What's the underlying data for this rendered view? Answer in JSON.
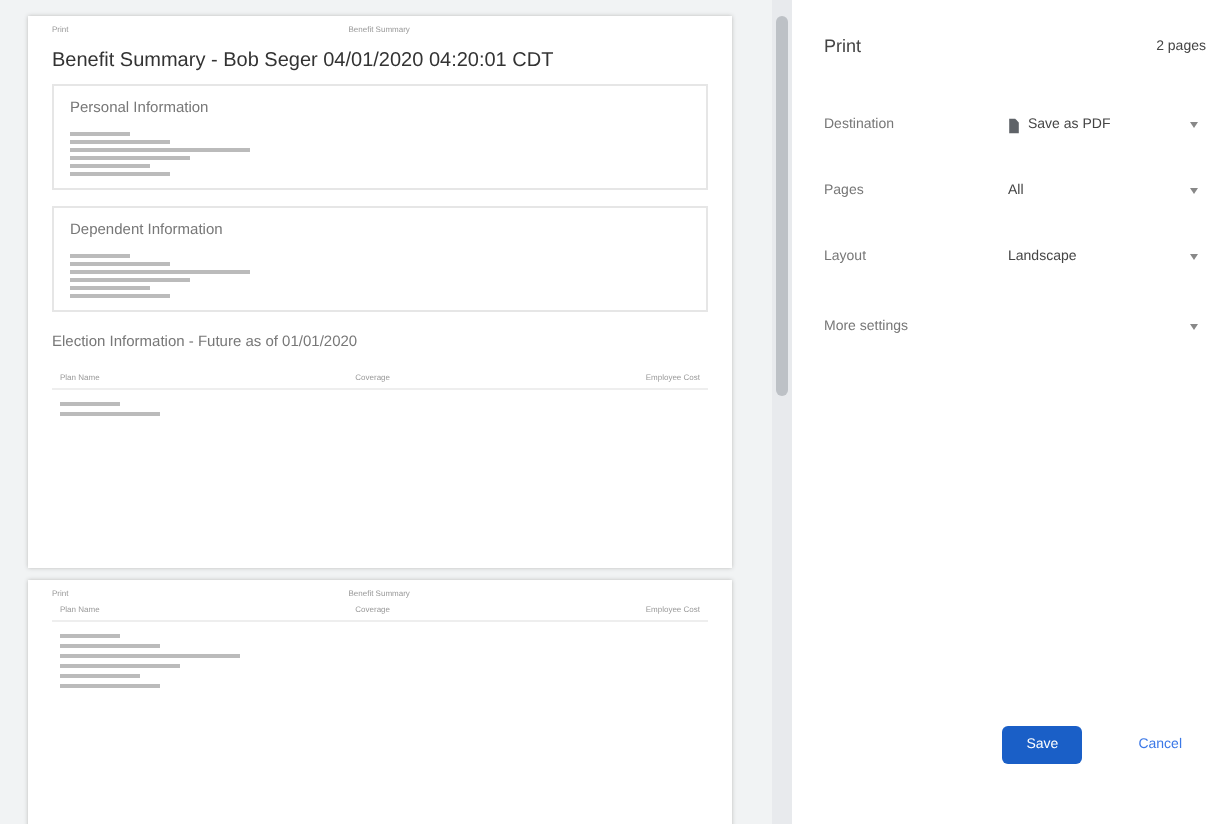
{
  "preview": {
    "pages": [
      {
        "header_left": "Print",
        "header_center": "Benefit Summary",
        "title": "Benefit Summary - Bob Seger 04/01/2020 04:20:01 CDT",
        "sections": [
          {
            "heading": "Personal Information"
          },
          {
            "heading": "Dependent Information"
          }
        ],
        "election_heading": "Election Information - Future as of 01/01/2020",
        "columns": [
          "Plan Name",
          "Coverage",
          "Employee Cost"
        ]
      },
      {
        "header_left": "Print",
        "header_center": "Benefit Summary",
        "columns": [
          "Plan Name",
          "Coverage",
          "Employee Cost"
        ]
      }
    ]
  },
  "panel": {
    "title": "Print",
    "page_count": "2 pages",
    "settings": [
      {
        "label": "Destination",
        "value": "Save as PDF",
        "kind": "destination"
      },
      {
        "label": "Pages",
        "value": "All",
        "kind": "select"
      },
      {
        "label": "Layout",
        "value": "Landscape",
        "kind": "select"
      }
    ],
    "more_settings": {
      "label": "More settings",
      "expanded": false
    },
    "buttons": [
      {
        "label": "Save",
        "kind": "primary"
      },
      {
        "label": "Cancel",
        "kind": "secondary"
      }
    ]
  }
}
